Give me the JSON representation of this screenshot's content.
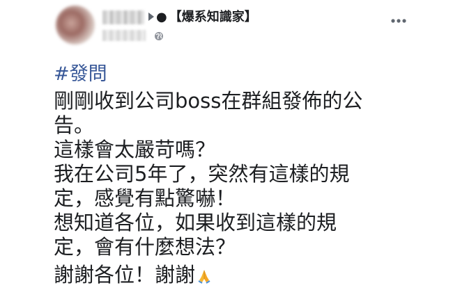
{
  "post": {
    "group_name": "【爆系知識家】",
    "group_prefix": "●",
    "hashtag": "#發問",
    "lines": [
      "剛剛收到公司boss在群組發佈的公",
      "告。",
      "這樣會太嚴苛嗎？",
      "我在公司5年了，突然有這樣的規",
      "定，感覺有點驚嚇！",
      "想知道各位，如果收到這樣的規",
      "定，會有什麼想法？",
      "謝謝各位！謝謝"
    ]
  },
  "icons": {
    "globe": "globe-icon",
    "menu": "more-options-icon",
    "pray": "folded-hands-icon",
    "privacy": "privacy-icon"
  },
  "colors": {
    "link": "#385898",
    "text": "#1c1e21",
    "pray_emoji": "#f7b731"
  }
}
